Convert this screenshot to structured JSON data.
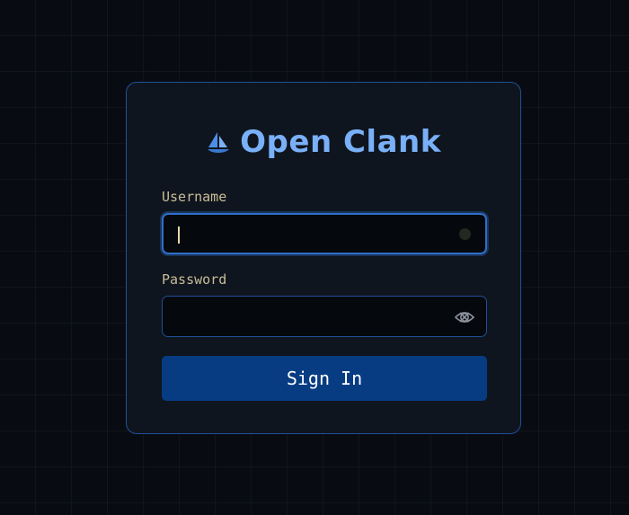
{
  "app": {
    "title": "Open Clank",
    "logo_icon": "sailboat-icon"
  },
  "form": {
    "username_label": "Username",
    "username_value": "",
    "password_label": "Password",
    "password_value": "",
    "password_toggle_icon": "eye-slash-icon",
    "submit_label": "Sign In"
  },
  "colors": {
    "background": "#080c12",
    "card": "#0f151e",
    "card_border": "#1f4f9a",
    "brand": "#79b0f8",
    "label": "#c9bd9a",
    "button": "#073c83",
    "focus_ring": "#2f6fc9"
  }
}
